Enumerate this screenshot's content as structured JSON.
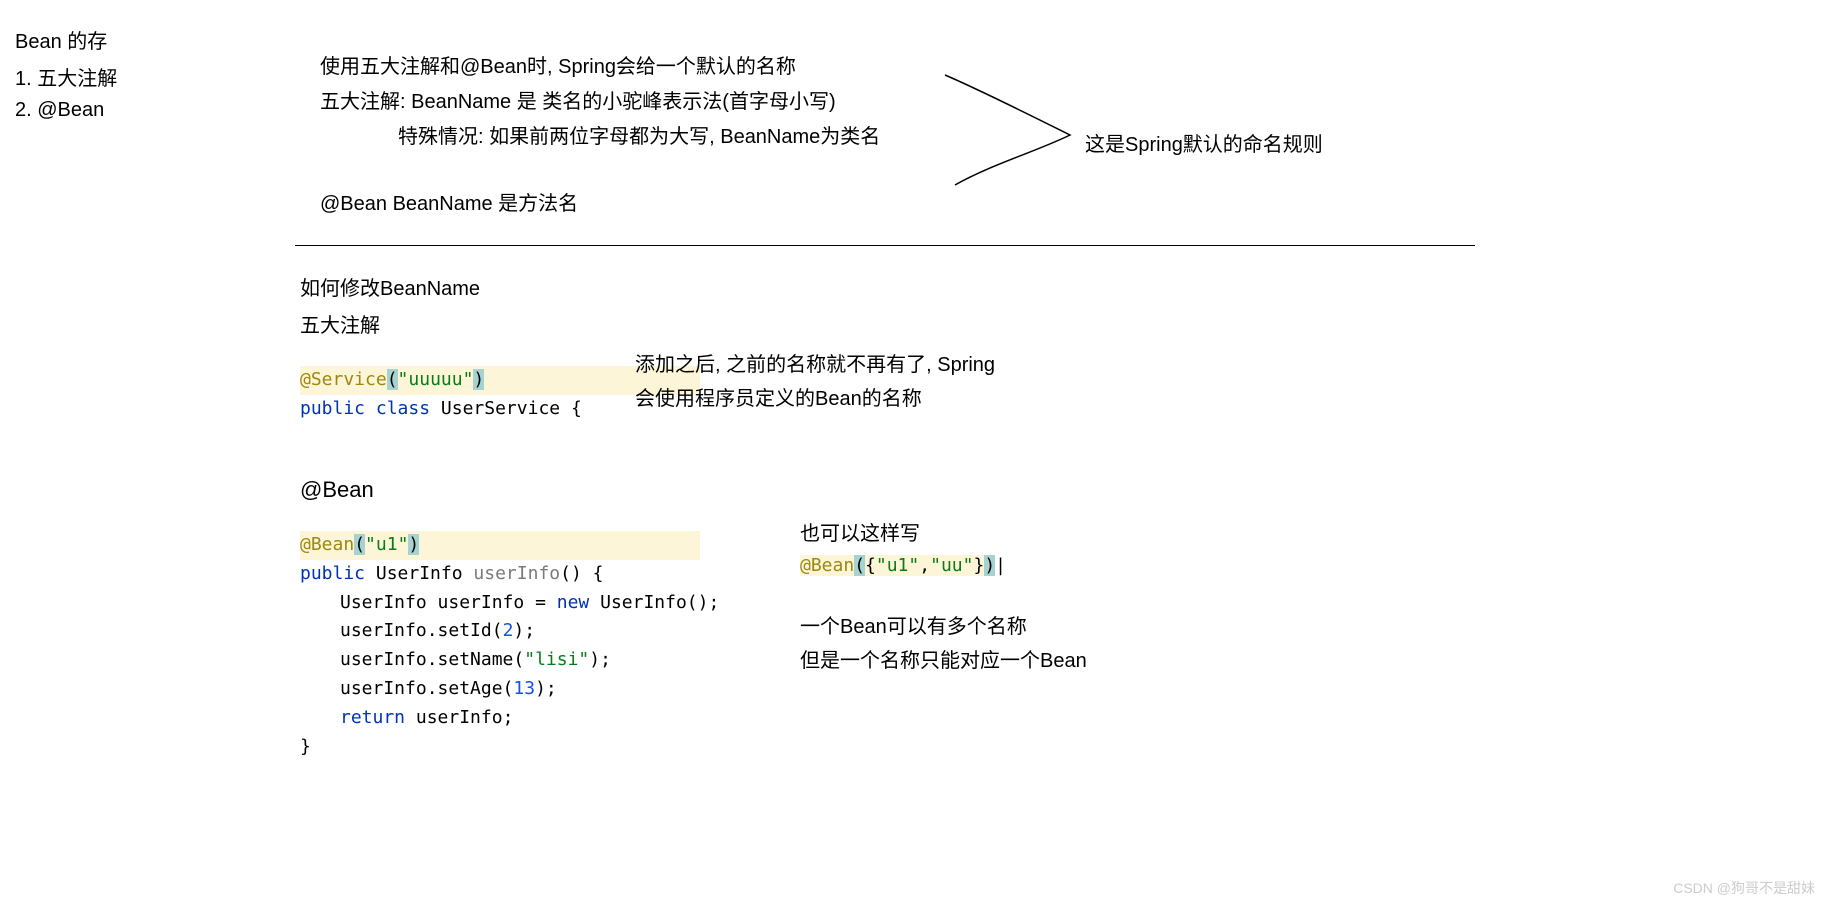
{
  "left": {
    "title": "Bean 的存",
    "item1": "1. 五大注解",
    "item2": "2. @Bean"
  },
  "main": {
    "line1": "使用五大注解和@Bean时, Spring会给一个默认的名称",
    "line2": "五大注解: BeanName 是 类名的小驼峰表示法(首字母小写)",
    "line3": "特殊情况: 如果前两位字母都为大写, BeanName为类名",
    "line4": "@Bean  BeanName 是方法名"
  },
  "annotation": "这是Spring默认的命名规则",
  "section2": {
    "title1": "如何修改BeanName",
    "title2": "五大注解",
    "code1": {
      "at": "@Service",
      "paren_open": "(",
      "str_open_q": "\"",
      "str_body": "uuuuu",
      "str_close_q": "\"",
      "paren_close": ")",
      "kw_public": "public",
      "kw_class": "class",
      "cls": "UserService {"
    },
    "side1": "添加之后, 之前的名称就不再有了, Spring",
    "side2": "会使用程序员定义的Bean的名称"
  },
  "section3": {
    "title": "@Bean",
    "code": {
      "at": "@Bean",
      "paren_open": "(",
      "str_q1": "\"",
      "str_body": "u1",
      "str_q2": "\"",
      "paren_close": ")",
      "kw_public": "public",
      "ret_type": "UserInfo",
      "method": "userInfo",
      "sig_end": "() {",
      "l1a": "UserInfo userInfo = ",
      "l1_new": "new",
      "l1b": " UserInfo();",
      "l2a": "userInfo.setId(",
      "l2_num": "2",
      "l2b": ");",
      "l3a": "userInfo.setName(",
      "l3_str": "\"lisi\"",
      "l3b": ");",
      "l4a": "userInfo.setAge(",
      "l4_num": "13",
      "l4b": ");",
      "l5_ret": "return",
      "l5b": " userInfo;",
      "close": "}"
    },
    "alt_label": "也可以这样写",
    "alt_code": {
      "at": "@Bean",
      "paren_open": "(",
      "brace": "{",
      "q1": "\"",
      "s1": "u1",
      "q2": "\"",
      "comma": ",",
      "q3": "\"",
      "s2": "uu",
      "q4": "\"",
      "brace_close": "}",
      "paren_close": ")",
      "cursor": "|"
    },
    "note1": "一个Bean可以有多个名称",
    "note2": "但是一个名称只能对应一个Bean"
  },
  "watermark": "CSDN @狗哥不是甜妹"
}
